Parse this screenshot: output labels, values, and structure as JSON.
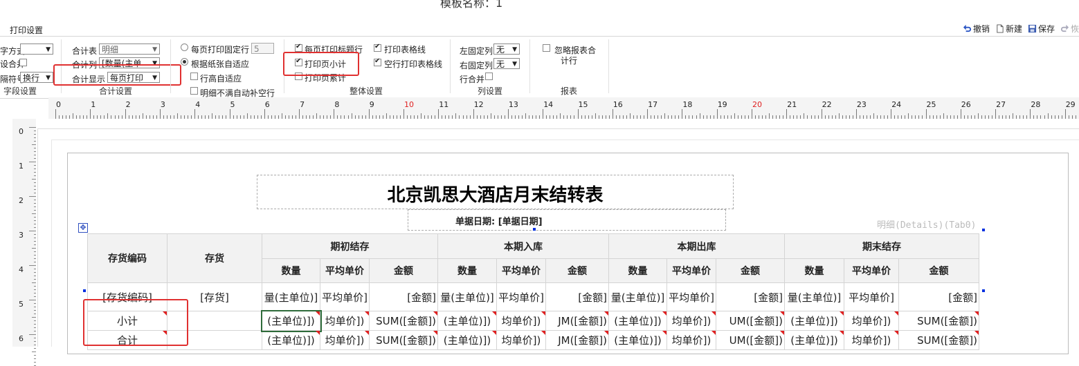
{
  "template_title": "模板名称：1",
  "toolbar": {
    "tab_label": "打印设置",
    "actions": [
      {
        "label": "撤销",
        "icon": "undo-icon",
        "enabled": true
      },
      {
        "label": "新建",
        "icon": "new-doc-icon",
        "enabled": true
      },
      {
        "label": "保存",
        "icon": "save-icon",
        "enabled": true
      },
      {
        "label": "恢",
        "icon": "redo-icon",
        "enabled": false
      }
    ]
  },
  "ribbon": {
    "field_group": {
      "title": "字段设置",
      "row1_label": "字方式",
      "row2_label": "设合并",
      "row3_label": "隔符号",
      "row3_value": "换行"
    },
    "total_group": {
      "title": "合计设置",
      "total_table_label": "合计表",
      "total_table_value": "明细",
      "total_col_label": "合计列",
      "total_col_value": "[数量(主单",
      "total_display_label": "合计显示",
      "total_display_value": "每页打印"
    },
    "page_group": {
      "fixed_rows_label": "每页打印固定行",
      "fixed_rows_value": "5",
      "auto_fit_label": "根据纸张自适应",
      "row_height_label": "行高自适应",
      "fill_blank_label": "明细不满自动补空行"
    },
    "overall_group": {
      "title": "整体设置",
      "print_title_rows": "每页打印标题行",
      "print_page_subtotal": "打印页小计",
      "print_page_cumulative": "打印页累计",
      "print_grid_lines": "打印表格线",
      "empty_row_grid": "空行打印表格线"
    },
    "column_group": {
      "title": "列设置",
      "left_fixed_label": "左固定列",
      "left_fixed_value": "无",
      "right_fixed_label": "右固定列",
      "right_fixed_value": "无",
      "row_merge_label": "行合并"
    },
    "report_group": {
      "title": "报表",
      "ignore_total_line1": "忽略报表合",
      "ignore_total_line2": "计行"
    }
  },
  "rulers": {
    "h_numbers": [
      "0",
      "1",
      "2",
      "3",
      "4",
      "5",
      "6",
      "7",
      "8",
      "9",
      "10",
      "11",
      "12",
      "13",
      "14",
      "15",
      "16",
      "17",
      "18",
      "19",
      "20",
      "21",
      "22",
      "23",
      "24",
      "25",
      "26",
      "27",
      "28",
      "29"
    ],
    "v_numbers": [
      "0",
      "1",
      "2",
      "3",
      "4",
      "5",
      "6"
    ],
    "highlight_color": "#e02020"
  },
  "report": {
    "title": "北京凯思大酒店月末结转表",
    "date_label": "单据日期: [单据日期]",
    "details_label": "明细(Details)(Tab0)",
    "header_groups": [
      "存货编码",
      "存货",
      "期初结存",
      "本期入库",
      "本期出库",
      "期末结存"
    ],
    "sub_headers": [
      "数量",
      "平均单价",
      "金额",
      "数量",
      "平均单价",
      "金额",
      "数量",
      "平均单价",
      "金额",
      "数量",
      "平均单价",
      "金额"
    ],
    "data_row": [
      "[存货编码]",
      "[存货]",
      "量(主单位)]",
      "平均单价]",
      "[金额]",
      "量(主单位)]",
      "平均单价]",
      "[金额]",
      "量(主单位)]",
      "平均单价]",
      "[金额]",
      "量(主单位)]",
      "平均单价]",
      "[金额]"
    ],
    "subtotal_row": [
      "小计",
      "",
      "(主单位)])",
      "均单价])",
      "SUM([金额])",
      "(主单位)])",
      "均单价])",
      "JM([金额])",
      "(主单位)])",
      "均单价])",
      "UM([金额])",
      "(主单位)])",
      "均单价])",
      "SUM([金额])"
    ],
    "total_row": [
      "合计",
      "",
      "(主单位)])",
      "均单价])",
      "SUM([金额])",
      "(主单位)])",
      "均单价])",
      "JM([金额])",
      "(主单位)])",
      "均单价])",
      "UM([金额])",
      "(主单位)])",
      "均单价])",
      "SUM([金额])"
    ]
  },
  "colors": {
    "highlight_red": "#e03030",
    "accent_blue": "#0030e0"
  }
}
